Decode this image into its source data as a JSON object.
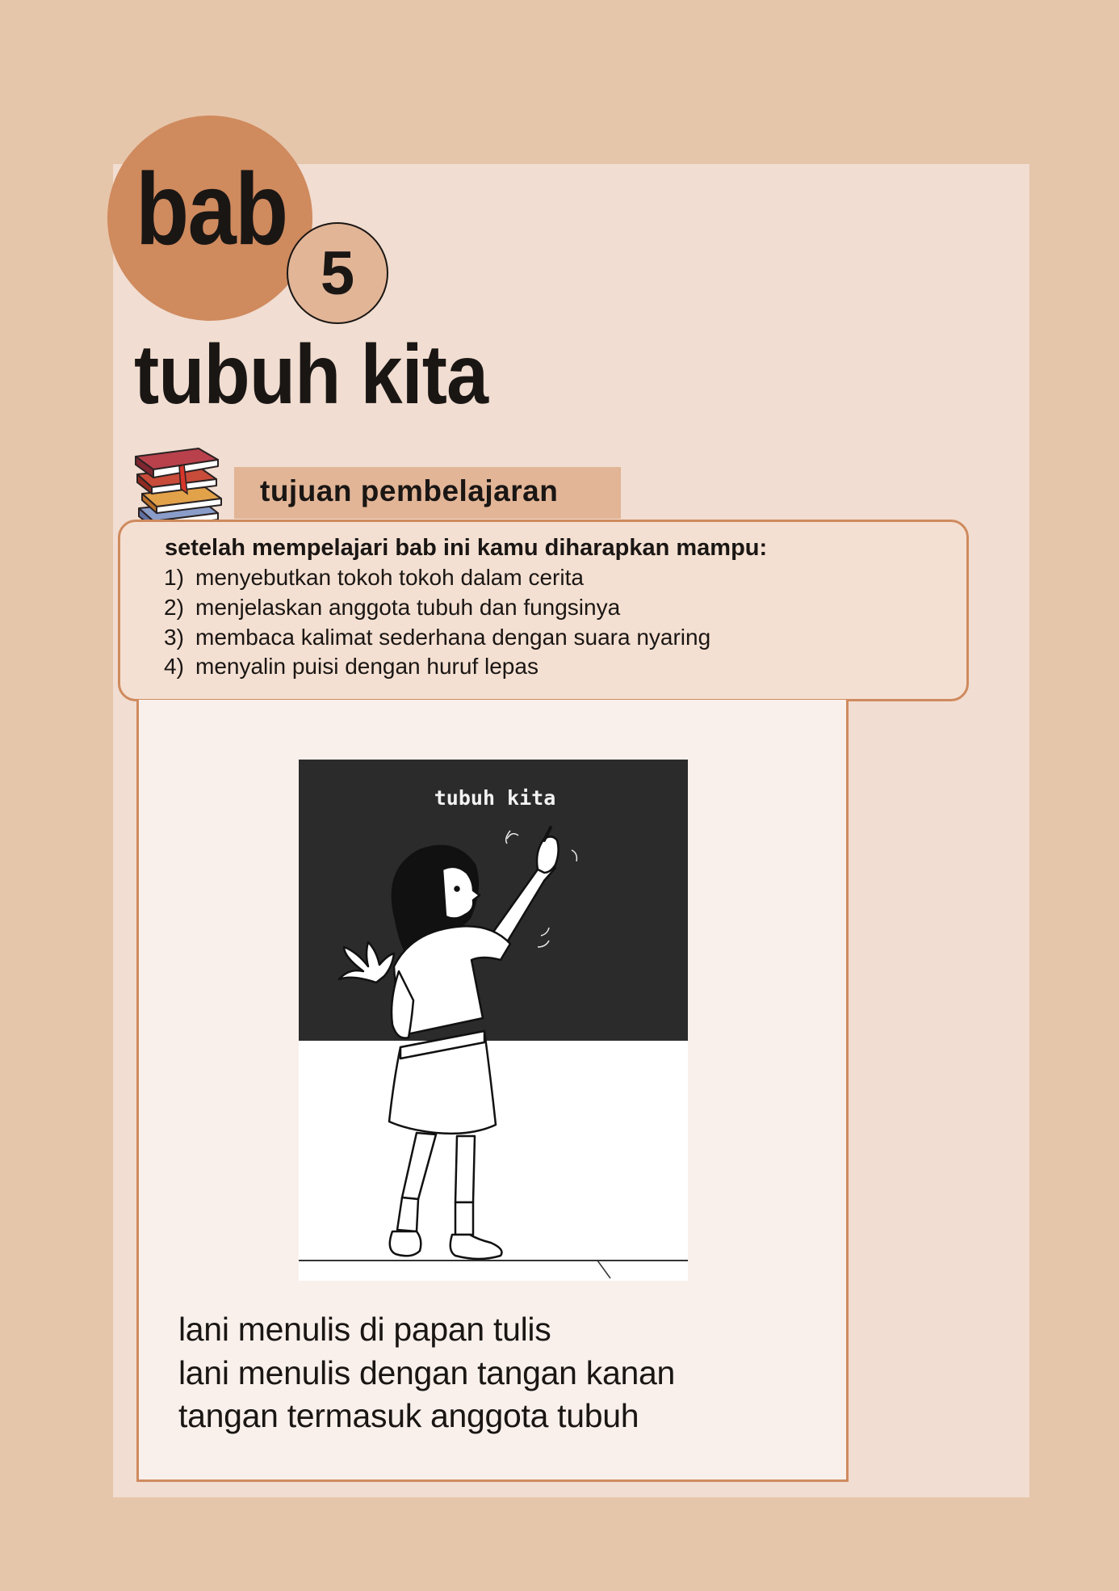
{
  "chapter": {
    "label": "bab",
    "number": "5",
    "title": "tubuh kita"
  },
  "objectives": {
    "header": "tujuan  pembelajaran",
    "intro": "setelah mempelajari bab ini kamu diharapkan mampu:",
    "items": [
      {
        "num": "1)",
        "text": "menyebutkan tokoh tokoh dalam cerita"
      },
      {
        "num": "2)",
        "text": "menjelaskan anggota tubuh dan fungsinya"
      },
      {
        "num": "3)",
        "text": "membaca kalimat sederhana dengan suara nyaring"
      },
      {
        "num": "4)",
        "text": "menyalin puisi dengan huruf lepas"
      }
    ]
  },
  "illustration": {
    "blackboard_text": "tubuh kita"
  },
  "story": {
    "lines": [
      "lani menulis di papan tulis",
      "lani menulis dengan tangan kanan",
      "tangan termasuk anggota tubuh"
    ]
  },
  "colors": {
    "page_background": "#e6c6aa",
    "panel": "#f1ddd1",
    "accent": "#cf8a5e",
    "accent_light": "#e2b597",
    "content_box": "#f9f0eb",
    "text": "#1a1614"
  }
}
